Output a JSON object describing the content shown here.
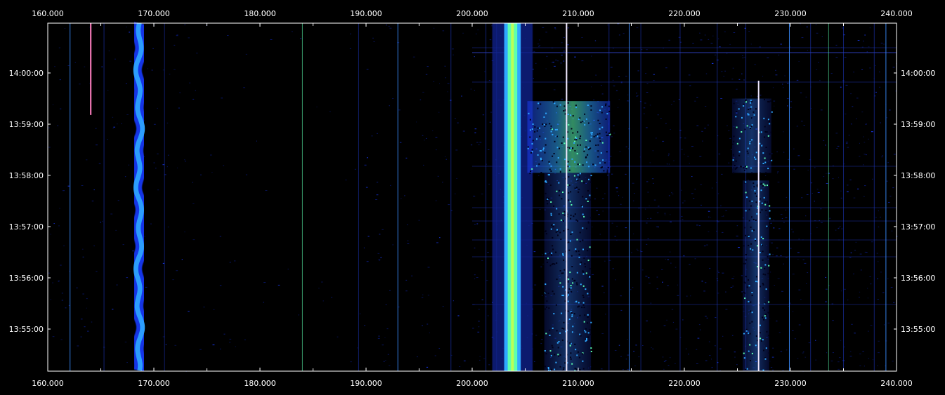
{
  "waterfall": {
    "frequency_ticks_top": [
      "160.000",
      "170.000",
      "180.000",
      "190.000",
      "200.000",
      "210.000",
      "220.000",
      "230.000",
      "240.000"
    ],
    "frequency_ticks_bottom": [
      "160.000",
      "170.000",
      "180.000",
      "190.000",
      "200.000",
      "210.000",
      "220.000",
      "230.000",
      "240.000"
    ],
    "time_ticks_left": [
      "14:00:00",
      "13:59:00",
      "13:58:00",
      "13:57:00",
      "13:56:00",
      "13:55:00"
    ],
    "time_ticks_right": [
      "14:00:00",
      "13:59:00",
      "13:58:00",
      "13:57:00",
      "13:56:00",
      "13:55:00"
    ],
    "colors": {
      "background": "#000000",
      "frame": "#ffffff",
      "noise": "#0a1a7a",
      "signal_low": "#1a3cff",
      "signal_mid": "#2fa8ff",
      "signal_high": "#5cffb0",
      "signal_peak": "#d4ff40",
      "carrier_pink": "#ff7fc0",
      "carrier_white": "#f0e8ff"
    },
    "signals": [
      {
        "kind": "carrier",
        "freq": 164.05,
        "t_start": 13.9,
        "t_end": 14.82,
        "intensity": "pink"
      },
      {
        "kind": "wavy-band",
        "freq": 168.6,
        "width": 0.9,
        "t_start": 14.0,
        "t_end": 17.0,
        "intensity": "mid"
      },
      {
        "kind": "band",
        "freq": 203.8,
        "width": 0.9,
        "t_start": 14.0,
        "t_end": 17.0,
        "intensity": "peak"
      },
      {
        "kind": "burst",
        "freq_start": 205.2,
        "freq_end": 213.0,
        "t_start": 14.55,
        "t_end": 15.95,
        "intensity": "high"
      },
      {
        "kind": "burst",
        "freq_start": 206.8,
        "freq_end": 211.2,
        "t_start": 15.95,
        "t_end": 17.0,
        "intensity": "mid"
      },
      {
        "kind": "carrier",
        "freq": 208.9,
        "t_start": 14.0,
        "t_end": 17.0,
        "intensity": "white"
      },
      {
        "kind": "burst",
        "freq_start": 224.5,
        "freq_end": 228.2,
        "t_start": 14.5,
        "t_end": 15.95,
        "intensity": "mid"
      },
      {
        "kind": "burst",
        "freq_start": 225.5,
        "freq_end": 228.0,
        "t_start": 16.1,
        "t_end": 17.0,
        "intensity": "mid"
      },
      {
        "kind": "carrier",
        "freq": 227.0,
        "t_start": 14.15,
        "t_end": 17.0,
        "intensity": "white"
      }
    ],
    "spurs": [
      162.1,
      165.3,
      171.0,
      184.0,
      189.3,
      193.0,
      198.0,
      201.3,
      202.3,
      212.9,
      214.8,
      215.9,
      219.6,
      223.1,
      225.8,
      229.9,
      231.9,
      233.6,
      235.0,
      237.9,
      239.0
    ]
  }
}
